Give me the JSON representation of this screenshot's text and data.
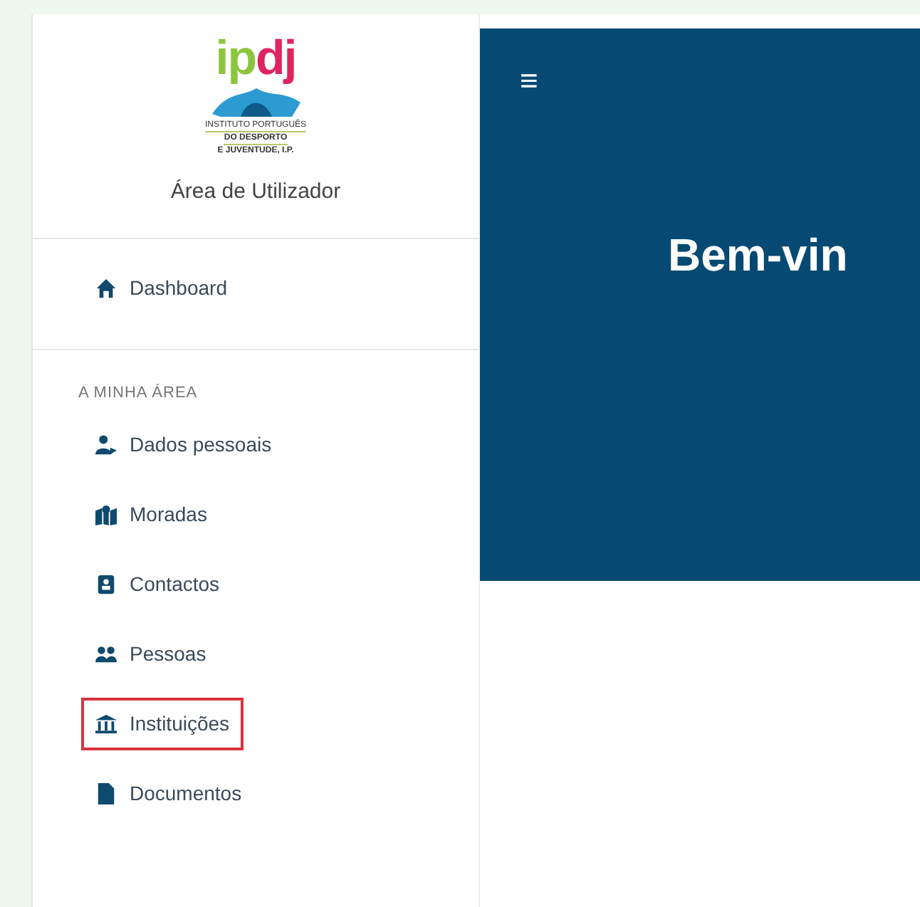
{
  "logo": {
    "mark": "ipdj",
    "lines": [
      "INSTITUTO PORTUGUÊS",
      "DO DESPORTO",
      "E JUVENTUDE, I.P."
    ]
  },
  "sidebar": {
    "title": "Área de Utilizador",
    "top_items": [
      {
        "label": "Dashboard",
        "highlighted": false
      }
    ],
    "section_label": "A MINHA ÁREA",
    "items": [
      {
        "label": "Dados pessoais",
        "highlighted": false
      },
      {
        "label": "Moradas",
        "highlighted": false
      },
      {
        "label": "Contactos",
        "highlighted": false
      },
      {
        "label": "Pessoas",
        "highlighted": false
      },
      {
        "label": "Instituições",
        "highlighted": true
      },
      {
        "label": "Documentos",
        "highlighted": false
      }
    ]
  },
  "main": {
    "menu_glyph": "≡",
    "heading": "Bem-vin"
  }
}
